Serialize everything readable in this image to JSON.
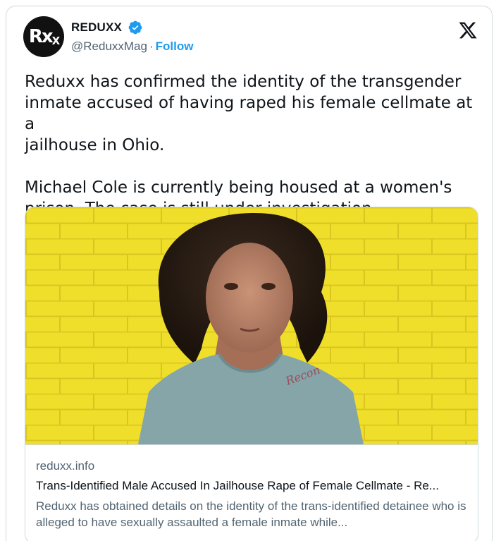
{
  "account": {
    "display_name": "REDUXX",
    "handle": "@ReduxxMag",
    "separator": "·",
    "follow_label": "Follow",
    "avatar_text_big": "Rx",
    "avatar_text_small": "X",
    "verified_color": "#1d9bf0"
  },
  "tweet": {
    "text": "Reduxx has confirmed the identity of the transgender\ninmate accused of having raped his female cellmate at a\njailhouse in Ohio.\n\nMichael Cole is currently being housed at a women's\nprison. The case is still under investigation."
  },
  "link_card": {
    "domain": "reduxx.info",
    "title": "Trans-Identified Male Accused In Jailhouse Rape of Female Cellmate - Re...",
    "description": "Reduxx has obtained details on the identity of the trans-identified detainee who is alleged to have sexually assaulted a female inmate while...",
    "shirt_scribble": "Recon"
  },
  "colors": {
    "accent": "#1d9bf0",
    "wall": "#f1e12a",
    "shirt": "#86a5a8"
  }
}
